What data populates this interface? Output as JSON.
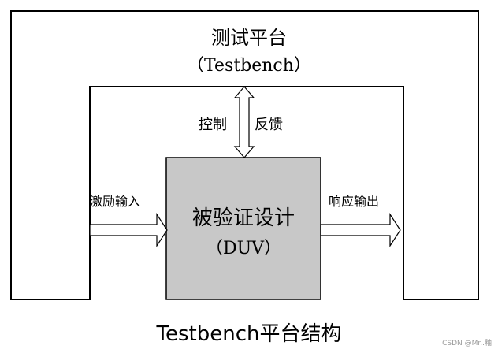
{
  "testbench": {
    "title": "测试平台",
    "subtitle": "（Testbench）"
  },
  "arrows": {
    "control_label": "控制",
    "feedback_label": "反馈",
    "stimulus_label": "激励输入",
    "response_label": "响应输出"
  },
  "duv": {
    "name": "被验证设计",
    "abbr": "（DUV）",
    "fill_color": "#c8c8c8"
  },
  "caption": "Testbench平台结构",
  "watermark": "CSDN @Mr..釉"
}
